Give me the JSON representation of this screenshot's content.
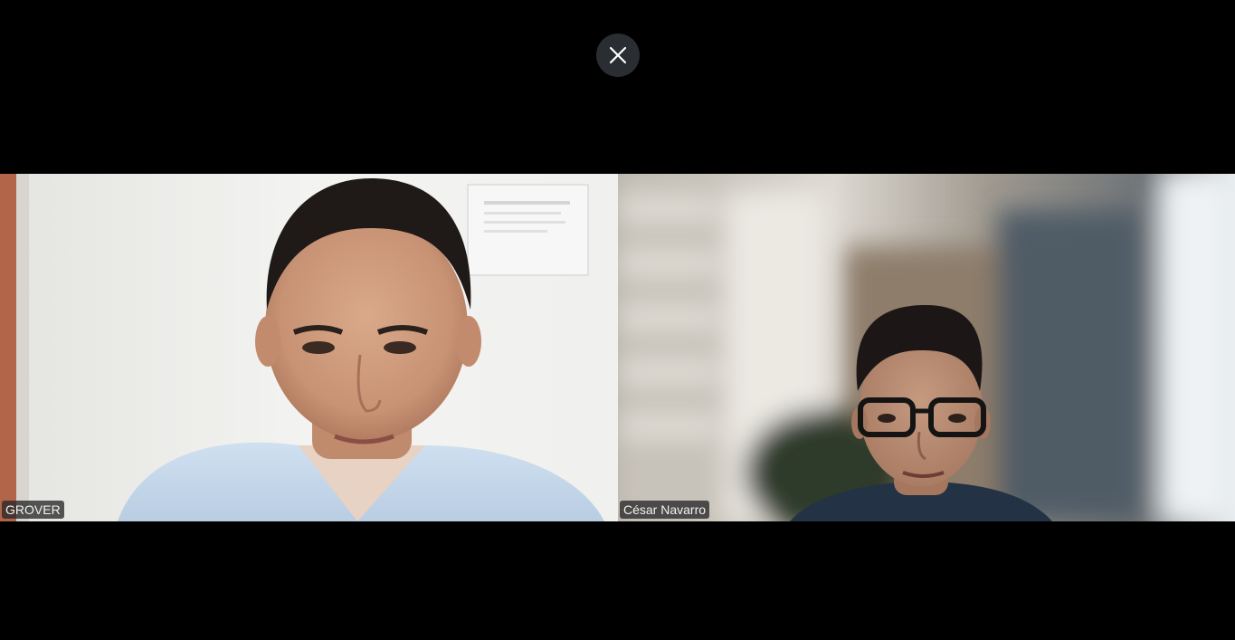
{
  "controls": {
    "close_icon": "close-icon"
  },
  "participants": [
    {
      "name": "GROVER"
    },
    {
      "name": "César Navarro"
    }
  ]
}
